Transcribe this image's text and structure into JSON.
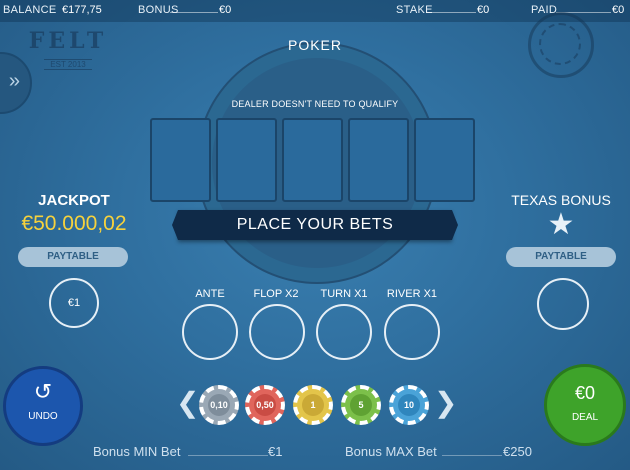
{
  "topbar": {
    "balance_label": "BALANCE",
    "balance_value": "€177,75",
    "bonus_label": "BONUS",
    "bonus_value": "€0",
    "stake_label": "STAKE",
    "stake_value": "€0",
    "paid_label": "PAID",
    "paid_value": "€0"
  },
  "logo": {
    "brand": "FELT",
    "tagline": "EST 2013"
  },
  "table": {
    "title": "POKER",
    "qualify_note": "DEALER DOESN'T NEED TO QUALIFY",
    "banner": "PLACE YOUR BETS"
  },
  "jackpot": {
    "title": "JACKPOT",
    "amount": "€50.000,02",
    "paytable": "PAYTABLE",
    "bet": "€1"
  },
  "texas_bonus": {
    "title": "TEXAS BONUS",
    "paytable": "PAYTABLE"
  },
  "bet_spots": [
    {
      "label": "ANTE"
    },
    {
      "label": "FLOP X2"
    },
    {
      "label": "TURN X1"
    },
    {
      "label": "RIVER X1"
    }
  ],
  "chips": [
    {
      "value": "0,10",
      "color": "#9aa8b5"
    },
    {
      "value": "0,50",
      "color": "#e0655c"
    },
    {
      "value": "1",
      "color": "#e3c54a"
    },
    {
      "value": "5",
      "color": "#7cc04a"
    },
    {
      "value": "10",
      "color": "#4aa3d8"
    }
  ],
  "buttons": {
    "undo": "UNDO",
    "undo_icon": "undo-arrow-icon",
    "deal_amount": "€0",
    "deal": "DEAL"
  },
  "limits": {
    "min_label": "Bonus MIN Bet",
    "min_value": "€1",
    "max_label": "Bonus MAX Bet",
    "max_value": "€250"
  },
  "colors": {
    "felt": "#2f6f9f",
    "jackpot_amount": "#f6d23c",
    "undo_button": "#1c56ad",
    "deal_button": "#3ea32a",
    "banner": "#0f2a48"
  }
}
